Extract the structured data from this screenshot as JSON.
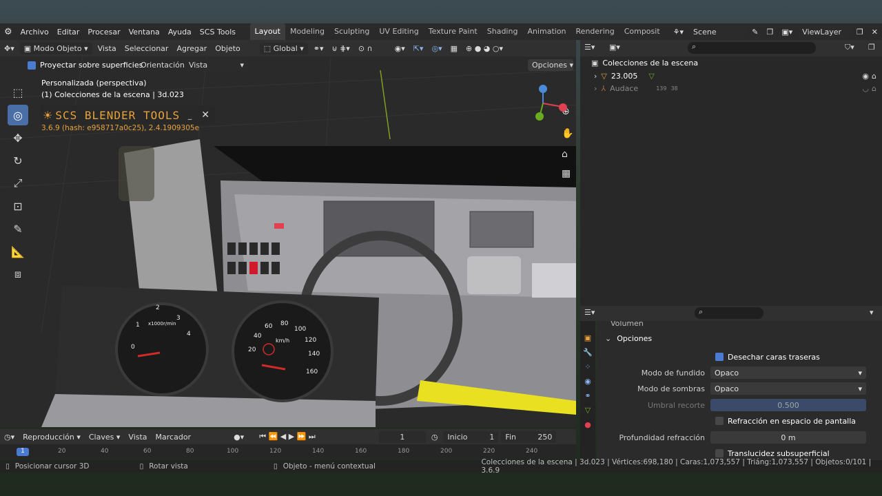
{
  "menu": {
    "items": [
      "Archivo",
      "Editar",
      "Procesar",
      "Ventana",
      "Ayuda",
      "SCS Tools"
    ]
  },
  "workspaces": {
    "tabs": [
      "Layout",
      "Modeling",
      "Sculpting",
      "UV Editing",
      "Texture Paint",
      "Shading",
      "Animation",
      "Rendering",
      "Composit"
    ],
    "active": "Layout"
  },
  "scene": {
    "name": "Scene",
    "viewlayer": "ViewLayer"
  },
  "viewport_header": {
    "mode": "Modo Objeto",
    "menus": [
      "Vista",
      "Seleccionar",
      "Agregar",
      "Objeto"
    ],
    "orientation": "Global"
  },
  "tool_settings": {
    "project_label": "Proyectar sobre superficies",
    "orientation_label": "Orientación:",
    "orientation_value": "Vista",
    "options": "Opciones"
  },
  "viewport_info": {
    "view": "Personalizada (perspectiva)",
    "collection": "(1) Colecciones de la escena | 3d.023"
  },
  "scs_panel": {
    "title": "SCS BLENDER TOOLS",
    "version": "3.6.9 (hash: e958717a0c25), 2.4.1909305e"
  },
  "dashboard": {
    "tacho_unit": "x1000r/min",
    "speed_unit": "km/h",
    "tacho_ticks": [
      "0",
      "1",
      "2",
      "3",
      "4"
    ],
    "speed_ticks": [
      "20",
      "40",
      "60",
      "80",
      "100",
      "120",
      "140",
      "160"
    ]
  },
  "outliner": {
    "root": "Colecciones de la escena",
    "items": [
      {
        "name": "23.005",
        "dim": false
      },
      {
        "name": "Audace",
        "dim": true,
        "badge1": "139",
        "badge2": "38"
      }
    ]
  },
  "properties": {
    "section_prev": "Volumen",
    "section": "Opciones",
    "backface": "Desechar caras traseras",
    "blend_label": "Modo de fundido",
    "blend_value": "Opaco",
    "shadow_label": "Modo de sombras",
    "shadow_value": "Opaco",
    "clip_label": "Umbral recorte",
    "clip_value": "0.500",
    "refraction": "Refracción en espacio de pantalla",
    "depth_label": "Profundidad refracción",
    "depth_value": "0 m",
    "sss": "Translucidez subsuperficial"
  },
  "timeline": {
    "menus": [
      "Reproducción",
      "Claves",
      "Vista",
      "Marcador"
    ],
    "frame": "1",
    "start_label": "Inicio",
    "start": "1",
    "end_label": "Fin",
    "end": "250",
    "ruler": [
      "1",
      "20",
      "40",
      "60",
      "80",
      "100",
      "120",
      "140",
      "160",
      "180",
      "200",
      "220",
      "240"
    ]
  },
  "status": {
    "left": "Posicionar cursor 3D",
    "middle": "Rotar vista",
    "context": "Objeto - menú contextual",
    "right": "Colecciones de la escena | 3d.023 | Vértices:698,180 | Caras:1,073,557 | Triáng:1,073,557 | Objetos:0/101 | 3.6.9"
  },
  "colors": {
    "accent": "#4a7bd1",
    "scs_orange": "#e8a23a",
    "selected_blue": "#4a6ea8"
  }
}
